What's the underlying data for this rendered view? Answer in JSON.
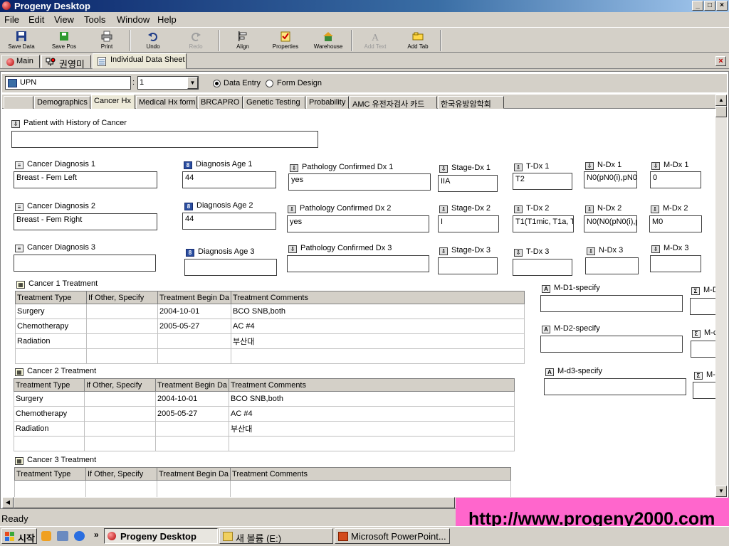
{
  "window": {
    "title": "Progeny Desktop",
    "min": "_",
    "max": "□",
    "close": "×"
  },
  "menu": [
    "File",
    "Edit",
    "View",
    "Tools",
    "Window",
    "Help"
  ],
  "toolbar": {
    "save_data": "Save Data",
    "save_pos": "Save Pos",
    "print": "Print",
    "undo": "Undo",
    "redo": "Redo",
    "align": "Align",
    "properties": "Properties",
    "warehouse": "Warehouse",
    "add_text": "Add Text",
    "add_tab": "Add Tab"
  },
  "doc_tabs": [
    "Main",
    "권영미",
    "Individual Data Sheet"
  ],
  "upn": {
    "field": "UPN",
    "separator": ":",
    "value": "1",
    "mode_data_entry": "Data Entry",
    "mode_form_design": "Form Design"
  },
  "section_tabs": [
    "Demographics",
    "Cancer Hx",
    "Medical Hx form",
    "BRCAPRO",
    "Genetic Testing",
    "Probability",
    "AMC 유전자검사 카드",
    "한국유방암학회"
  ],
  "form": {
    "patient_history_label": "Patient with History of Cancer",
    "patient_history_value": "",
    "dx": [
      {
        "diag_label": "Cancer Diagnosis 1",
        "diag": "Breast - Fem Left",
        "age_label": "Diagnosis Age 1",
        "age": "44",
        "path_label": "Pathology Confirmed Dx 1",
        "path": "yes",
        "stage_label": "Stage-Dx 1",
        "stage": "IIA",
        "t_label": "T-Dx 1",
        "t": "T2",
        "n_label": "N-Dx 1",
        "n": "N0(pN0(i),pN0(",
        "m_label": "M-Dx 1",
        "m": "0"
      },
      {
        "diag_label": "Cancer Diagnosis 2",
        "diag": "Breast - Fem Right",
        "age_label": "Diagnosis Age 2",
        "age": "44",
        "path_label": "Pathology Confirmed Dx 2",
        "path": "yes",
        "stage_label": "Stage-Dx 2",
        "stage": "I",
        "t_label": "T-Dx 2",
        "t": "T1(T1mic, T1a, T",
        "n_label": "N-Dx 2",
        "n": "N0(N0(pN0(i),p",
        "m_label": "M-Dx 2",
        "m": "M0"
      },
      {
        "diag_label": "Cancer Diagnosis 3",
        "diag": "",
        "age_label": "Diagnosis Age 3",
        "age": "",
        "path_label": "Pathology Confirmed Dx 3",
        "path": "",
        "stage_label": "Stage-Dx 3",
        "stage": "",
        "t_label": "T-Dx 3",
        "t": "",
        "n_label": "N-Dx 3",
        "n": "",
        "m_label": "M-Dx 3",
        "m": ""
      }
    ],
    "treatments": [
      {
        "label": "Cancer 1 Treatment",
        "columns": [
          "Treatment Type",
          "If Other, Specify",
          "Treatment Begin Da",
          "Treatment Comments"
        ],
        "rows": [
          [
            "Surgery",
            "",
            "2004-10-01",
            "BCO SNB,both"
          ],
          [
            "Chemotherapy",
            "",
            "2005-05-27",
            "AC #4"
          ],
          [
            "Radiation",
            "",
            "",
            "부산대"
          ]
        ]
      },
      {
        "label": "Cancer 2 Treatment",
        "columns": [
          "Treatment Type",
          "If Other, Specify",
          "Treatment Begin Da",
          "Treatment Comments"
        ],
        "rows": [
          [
            "Surgery",
            "",
            "2004-10-01",
            "BCO SNB,both"
          ],
          [
            "Chemotherapy",
            "",
            "2005-05-27",
            "AC #4"
          ],
          [
            "Radiation",
            "",
            "",
            "부산대"
          ]
        ]
      },
      {
        "label": "Cancer 3 Treatment",
        "columns": [
          "Treatment Type",
          "If Other, Specify",
          "Treatment Begin Da",
          "Treatment Comments"
        ],
        "rows": []
      }
    ],
    "specify": [
      {
        "label": "M-D1-specify",
        "value": "",
        "side": "M-D"
      },
      {
        "label": "M-D2-specify",
        "value": "",
        "side": "M-c"
      },
      {
        "label": "M-d3-specify",
        "value": "",
        "side": "M-"
      }
    ]
  },
  "status": "Ready",
  "banner": "http://www.progeny2000.com",
  "taskbar": {
    "start": "시작",
    "tasks": [
      "Progeny Desktop",
      "새 볼륨 (E:)",
      "Microsoft PowerPoint..."
    ]
  }
}
